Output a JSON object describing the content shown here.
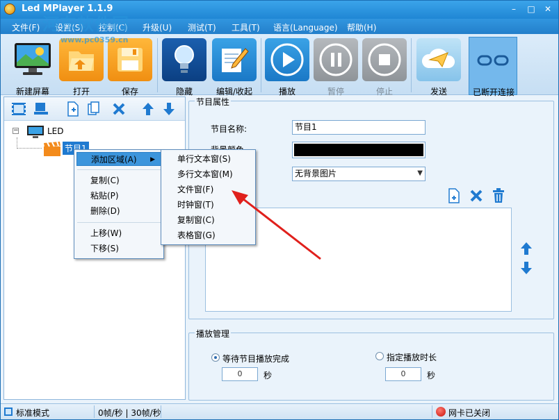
{
  "app": {
    "title": "Led MPlayer 1.1.9",
    "watermark": "河东软件园",
    "watermark_url": "www.pc0359.cn",
    "window_buttons": [
      "minimize",
      "maximize",
      "close"
    ]
  },
  "menu": [
    {
      "label": "文件(F)"
    },
    {
      "label": "设置(S)"
    },
    {
      "label": "控制(C)"
    },
    {
      "label": "升级(U)"
    },
    {
      "label": "测试(T)"
    },
    {
      "label": "工具(T)"
    },
    {
      "label": "语言(Language)"
    },
    {
      "label": "帮助(H)"
    }
  ],
  "toolbar": [
    {
      "label": "新建屏幕",
      "icon": "monitor-icon"
    },
    {
      "label": "打开",
      "icon": "folder-icon"
    },
    {
      "label": "保存",
      "icon": "floppy-icon"
    },
    {
      "label": "隐藏",
      "icon": "lightbulb-icon"
    },
    {
      "label": "编辑/收起",
      "icon": "notepad-pencil-icon"
    },
    {
      "label": "播放",
      "icon": "play-icon"
    },
    {
      "label": "暂停",
      "icon": "pause-icon",
      "disabled": true
    },
    {
      "label": "停止",
      "icon": "stop-icon",
      "disabled": true
    },
    {
      "label": "发送",
      "icon": "cloud-send-icon"
    },
    {
      "label": "已断开连接",
      "icon": "link-broken-icon",
      "active": true
    }
  ],
  "tree": {
    "root": "LED",
    "program": "节目1"
  },
  "context_menu": {
    "items": [
      "添加区域(A)",
      "复制(C)",
      "粘贴(P)",
      "删除(D)",
      "上移(W)",
      "下移(S)"
    ]
  },
  "submenu": {
    "items": [
      "单行文本窗(S)",
      "多行文本窗(M)",
      "文件窗(F)",
      "时钟窗(T)",
      "复制窗(C)",
      "表格窗(G)"
    ]
  },
  "program_props": {
    "legend": "节目属性",
    "name_label": "节目名称:",
    "name_value": "节目1",
    "bg_color_label": "背景颜色",
    "bg_color": "#000000",
    "bg_image_value": "无背景图片"
  },
  "play_mgmt": {
    "legend": "播放管理",
    "option1": "等待节目播放完成",
    "option1_value": "0",
    "option2": "指定播放时长",
    "option2_value": "0",
    "unit": "秒",
    "selected": "option1"
  },
  "statusbar": {
    "mode": "标准模式",
    "fps": "0帧/秒 | 30帧/秒",
    "network": "网卡已关闭"
  },
  "colors": {
    "accent": "#2d8fd6",
    "highlight": "#3c95dc",
    "arrow_red": "#e0201c"
  }
}
